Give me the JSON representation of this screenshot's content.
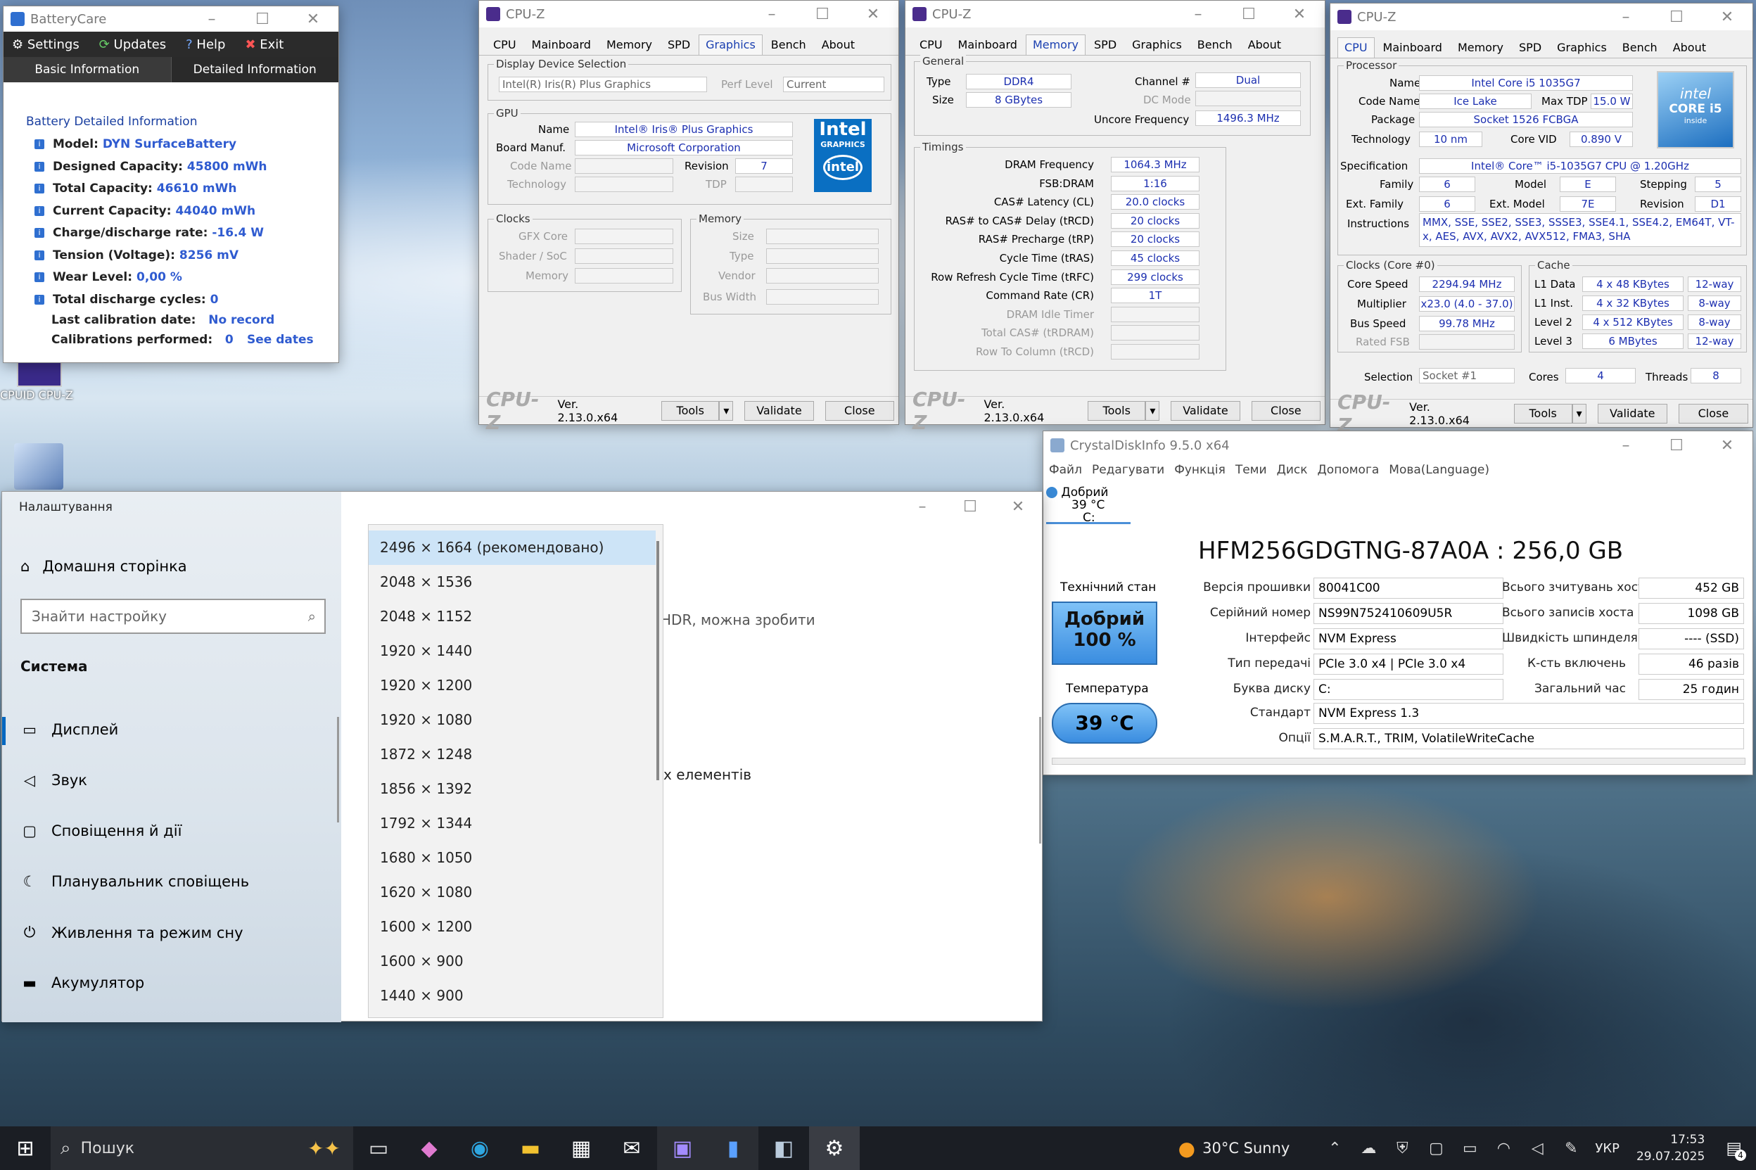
{
  "desktop": {
    "icon_cpuz_label": "CPUID CPU-Z"
  },
  "batterycare": {
    "title": "BatteryCare",
    "toolbar": {
      "settings": "Settings",
      "updates": "Updates",
      "help": "Help",
      "exit": "Exit"
    },
    "tabs": [
      "Basic Information",
      "Detailed Information"
    ],
    "section": "Battery Detailed Information",
    "rows": [
      {
        "label": "Model:",
        "value": "DYN SurfaceBattery"
      },
      {
        "label": "Designed Capacity:",
        "value": "45800 mWh"
      },
      {
        "label": "Total Capacity:",
        "value": "46610 mWh"
      },
      {
        "label": "Current Capacity:",
        "value": "44040 mWh"
      },
      {
        "label": "Charge/discharge rate:",
        "value": "-16.4 W"
      },
      {
        "label": "Tension (Voltage):",
        "value": "8256 mV"
      },
      {
        "label": "Wear Level:",
        "value": "0,00 %"
      },
      {
        "label": "Total discharge cycles:",
        "value": "0"
      }
    ],
    "last_cal_label": "Last calibration date:",
    "last_cal_value": "No record",
    "cal_perf_label": "Calibrations performed:",
    "cal_perf_value": "0",
    "see_dates": "See dates"
  },
  "cpuz_common": {
    "title": "CPU-Z",
    "tabs": [
      "CPU",
      "Mainboard",
      "Memory",
      "SPD",
      "Graphics",
      "Bench",
      "About"
    ],
    "logo": "CPU-Z",
    "version": "Ver. 2.13.0.x64",
    "tools": "Tools",
    "validate": "Validate",
    "close": "Close"
  },
  "cpuz_graphics": {
    "display_group": "Display Device Selection",
    "display_value": "Intel(R) Iris(R) Plus Graphics",
    "perf_label": "Perf Level",
    "perf_value": "Current",
    "gpu_group": "GPU",
    "name_label": "Name",
    "name_value": "Intel® Iris® Plus Graphics",
    "board_label": "Board Manuf.",
    "board_value": "Microsoft Corporation",
    "code_label": "Code Name",
    "rev_label": "Revision",
    "rev_value": "7",
    "tech_label": "Technology",
    "tdp_label": "TDP",
    "clocks_group": "Clocks",
    "gfx_label": "GFX Core",
    "shader_label": "Shader / SoC",
    "mem_label": "Memory",
    "memory_group": "Memory",
    "size_label": "Size",
    "type_label": "Type",
    "vendor_label": "Vendor",
    "bus_label": "Bus Width",
    "badge_top": "Intel",
    "badge_sub": "GRAPHICS",
    "badge_logo": "intel"
  },
  "cpuz_memory": {
    "general_group": "General",
    "type_label": "Type",
    "type_value": "DDR4",
    "size_label": "Size",
    "size_value": "8 GBytes",
    "channel_label": "Channel #",
    "channel_value": "Dual",
    "dc_label": "DC Mode",
    "uncore_label": "Uncore Frequency",
    "uncore_value": "1496.3 MHz",
    "timings_group": "Timings",
    "timings": [
      {
        "label": "DRAM Frequency",
        "value": "1064.3 MHz"
      },
      {
        "label": "FSB:DRAM",
        "value": "1:16"
      },
      {
        "label": "CAS# Latency (CL)",
        "value": "20.0 clocks"
      },
      {
        "label": "RAS# to CAS# Delay (tRCD)",
        "value": "20 clocks"
      },
      {
        "label": "RAS# Precharge (tRP)",
        "value": "20 clocks"
      },
      {
        "label": "Cycle Time (tRAS)",
        "value": "45 clocks"
      },
      {
        "label": "Row Refresh Cycle Time (tRFC)",
        "value": "299 clocks"
      },
      {
        "label": "Command Rate (CR)",
        "value": "1T"
      },
      {
        "label": "DRAM Idle Timer",
        "value": ""
      },
      {
        "label": "Total CAS# (tRDRAM)",
        "value": ""
      },
      {
        "label": "Row To Column (tRCD)",
        "value": ""
      }
    ]
  },
  "cpuz_cpu": {
    "processor_group": "Processor",
    "name_label": "Name",
    "name_value": "Intel Core i5 1035G7",
    "code_label": "Code Name",
    "code_value": "Ice Lake",
    "tdp_label": "Max TDP",
    "tdp_value": "15.0 W",
    "pkg_label": "Package",
    "pkg_value": "Socket 1526 FCBGA",
    "tech_label": "Technology",
    "tech_value": "10 nm",
    "vid_label": "Core VID",
    "vid_value": "0.890 V",
    "spec_label": "Specification",
    "spec_value": "Intel® Core™ i5-1035G7 CPU @ 1.20GHz",
    "family_label": "Family",
    "family_value": "6",
    "model_label": "Model",
    "model_value": "E",
    "stepping_label": "Stepping",
    "stepping_value": "5",
    "extfam_label": "Ext. Family",
    "extfam_value": "6",
    "extmodel_label": "Ext. Model",
    "extmodel_value": "7E",
    "revision_label": "Revision",
    "revision_value": "D1",
    "instr_label": "Instructions",
    "instr_value": "MMX, SSE, SSE2, SSE3, SSSE3, SSE4.1, SSE4.2, EM64T, VT-x, AES, AVX, AVX2, AVX512, FMA3, SHA",
    "clocks_group": "Clocks (Core #0)",
    "speed_label": "Core Speed",
    "speed_value": "2294.94 MHz",
    "mult_label": "Multiplier",
    "mult_value": "x23.0 (4.0 - 37.0)",
    "bus_label": "Bus Speed",
    "bus_value": "99.78 MHz",
    "fsb_label": "Rated FSB",
    "cache_group": "Cache",
    "cache": [
      {
        "label": "L1 Data",
        "value": "4 x 48 KBytes",
        "way": "12-way"
      },
      {
        "label": "L1 Inst.",
        "value": "4 x 32 KBytes",
        "way": "8-way"
      },
      {
        "label": "Level 2",
        "value": "4 x 512 KBytes",
        "way": "8-way"
      },
      {
        "label": "Level 3",
        "value": "6 MBytes",
        "way": "12-way"
      }
    ],
    "selection_label": "Selection",
    "selection_value": "Socket #1",
    "cores_label": "Cores",
    "cores_value": "4",
    "threads_label": "Threads",
    "threads_value": "8",
    "badge_line1": "intel",
    "badge_line2": "CORE i5",
    "badge_line3": "inside"
  },
  "crystal": {
    "title": "CrystalDiskInfo 9.5.0 x64",
    "menu": [
      "Файл",
      "Редагувати",
      "Функція",
      "Теми",
      "Диск",
      "Допомога",
      "Мова(Language)"
    ],
    "disk_tab_status": "Добрий",
    "disk_tab_temp": "39 °C",
    "disk_tab_letter": "C:",
    "heading": "HFM256GDGTNG-87A0A : 256,0 GB",
    "health_label": "Технічний стан",
    "health_status": "Добрий",
    "health_pct": "100 %",
    "temp_label": "Температура",
    "temp_value": "39 °C",
    "left_rows": [
      {
        "label": "Версія прошивки",
        "value": "80041C00"
      },
      {
        "label": "Серійний номер",
        "value": "NS99N752410609U5R"
      },
      {
        "label": "Інтерфейс",
        "value": "NVM Express"
      },
      {
        "label": "Тип передачі",
        "value": "PCIe 3.0 x4 | PCIe 3.0 x4"
      },
      {
        "label": "Буква диску",
        "value": "C:"
      }
    ],
    "right_rows": [
      {
        "label": "Всього зчитувань хоста",
        "value": "452 GB"
      },
      {
        "label": "Всього записів хоста",
        "value": "1098 GB"
      },
      {
        "label": "Швидкість шпинделя",
        "value": "---- (SSD)"
      },
      {
        "label": "К-сть включень",
        "value": "46 разів"
      },
      {
        "label": "Загальний час",
        "value": "25 годин"
      }
    ],
    "std_label": "Стандарт",
    "std_value": "NVM Express 1.3",
    "opt_label": "Опції",
    "opt_value": "S.M.A.R.T., TRIM, VolatileWriteCache"
  },
  "settings": {
    "title": "Налаштування",
    "home": "Домашня сторінка",
    "search_placeholder": "Знайти настройку",
    "section": "Система",
    "items": [
      "Дисплей",
      "Звук",
      "Сповіщення й дії",
      "Планувальник сповіщень",
      "Живлення та режим сну",
      "Акумулятор"
    ],
    "partial_text1": "HDR, можна зробити",
    "partial_text2": "х елементів",
    "resolutions": [
      "2496 × 1664 (рекомендовано)",
      "2048 × 1536",
      "2048 × 1152",
      "1920 × 1440",
      "1920 × 1200",
      "1920 × 1080",
      "1872 × 1248",
      "1856 × 1392",
      "1792 × 1344",
      "1680 × 1050",
      "1620 × 1080",
      "1600 × 1200",
      "1600 × 900",
      "1440 × 900"
    ]
  },
  "taskbar": {
    "search": "Пошук",
    "weather": "30°C  Sunny",
    "lang": "УКР",
    "time": "17:53",
    "date": "29.07.2025",
    "notif_count": "4"
  }
}
